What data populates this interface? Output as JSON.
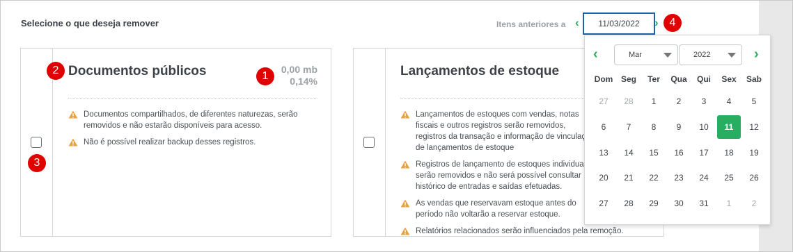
{
  "header": {
    "title": "Selecione o que deseja remover",
    "prior_label": "Itens anteriores a",
    "date_value": "11/03/2022"
  },
  "cards": [
    {
      "title": "Documentos públicos",
      "size_mb": "0,00 mb",
      "size_pct": "0,14%",
      "checked": false,
      "notes": [
        "Documentos compartilhados, de diferentes naturezas, serão removidos e não estarão disponíveis para acesso.",
        "Não é possível realizar backup desses registros."
      ]
    },
    {
      "title": "Lançamentos de estoque",
      "checked": false,
      "notes": [
        "Lançamentos de estoques com vendas, notas fiscais e outros registros serão removidos, registros da transação e informação de vinculação de lançamentos de estoque",
        "Registros de lançamento de estoques individuais serão removidos e não será possível consultar histórico de entradas e saídas efetuadas.",
        "As vendas que reservavam estoque antes do período não voltarão a reservar estoque.",
        "Relatórios relacionados serão influenciados pela remoção."
      ]
    }
  ],
  "calendar": {
    "month": "Mar",
    "year": "2022",
    "weekdays": [
      "Dom",
      "Seg",
      "Ter",
      "Qua",
      "Qui",
      "Sex",
      "Sab"
    ],
    "weeks": [
      [
        "27",
        "28",
        "1",
        "2",
        "3",
        "4",
        "5"
      ],
      [
        "6",
        "7",
        "8",
        "9",
        "10",
        "11",
        "12"
      ],
      [
        "13",
        "14",
        "15",
        "16",
        "17",
        "18",
        "19"
      ],
      [
        "20",
        "21",
        "22",
        "23",
        "24",
        "25",
        "26"
      ],
      [
        "27",
        "28",
        "29",
        "30",
        "31",
        "1",
        "2"
      ]
    ],
    "muted": [
      [
        0,
        0
      ],
      [
        0,
        1
      ],
      [
        4,
        5
      ],
      [
        4,
        6
      ]
    ],
    "selected": [
      1,
      5
    ]
  },
  "badges": [
    "1",
    "2",
    "3",
    "4"
  ],
  "colors": {
    "accent": "#27ae60",
    "badge": "#e00000",
    "focus_border": "#1f5fa8",
    "warning": "#e8a33d"
  }
}
